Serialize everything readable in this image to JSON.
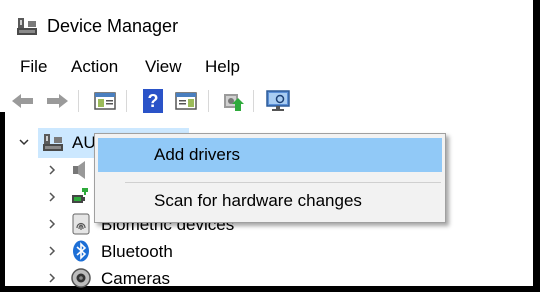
{
  "window": {
    "title": "Device Manager",
    "app_icon": "device-manager-icon"
  },
  "menubar": {
    "items": [
      {
        "label": "File"
      },
      {
        "label": "Action"
      },
      {
        "label": "View"
      },
      {
        "label": "Help"
      }
    ]
  },
  "toolbar": {
    "buttons": [
      {
        "icon": "back-arrow-icon"
      },
      {
        "icon": "forward-arrow-icon"
      },
      {
        "icon": "show-hide-console-tree-icon"
      },
      {
        "icon": "help-icon"
      },
      {
        "icon": "properties-pane-icon"
      },
      {
        "icon": "update-driver-icon"
      },
      {
        "icon": "scan-hardware-monitor-icon"
      }
    ]
  },
  "tree": {
    "root_label": "AUF",
    "items": [
      {
        "label": "",
        "icon": "audio-speaker-icon"
      },
      {
        "label": "",
        "icon": "batteries-plug-icon"
      },
      {
        "label": "Biometric devices",
        "icon": "fingerprint-icon"
      },
      {
        "label": "Bluetooth",
        "icon": "bluetooth-icon"
      },
      {
        "label": "Cameras",
        "icon": "camera-icon"
      }
    ]
  },
  "context_menu": {
    "items": [
      {
        "label": "Add drivers",
        "highlighted": true
      },
      {
        "label": "Scan for hardware changes",
        "highlighted": false
      }
    ]
  },
  "colors": {
    "selection": "#cce8ff",
    "menu_highlight": "#91c9f7",
    "menu_bg": "#f2f2f2",
    "help_blue": "#2a53c8"
  }
}
